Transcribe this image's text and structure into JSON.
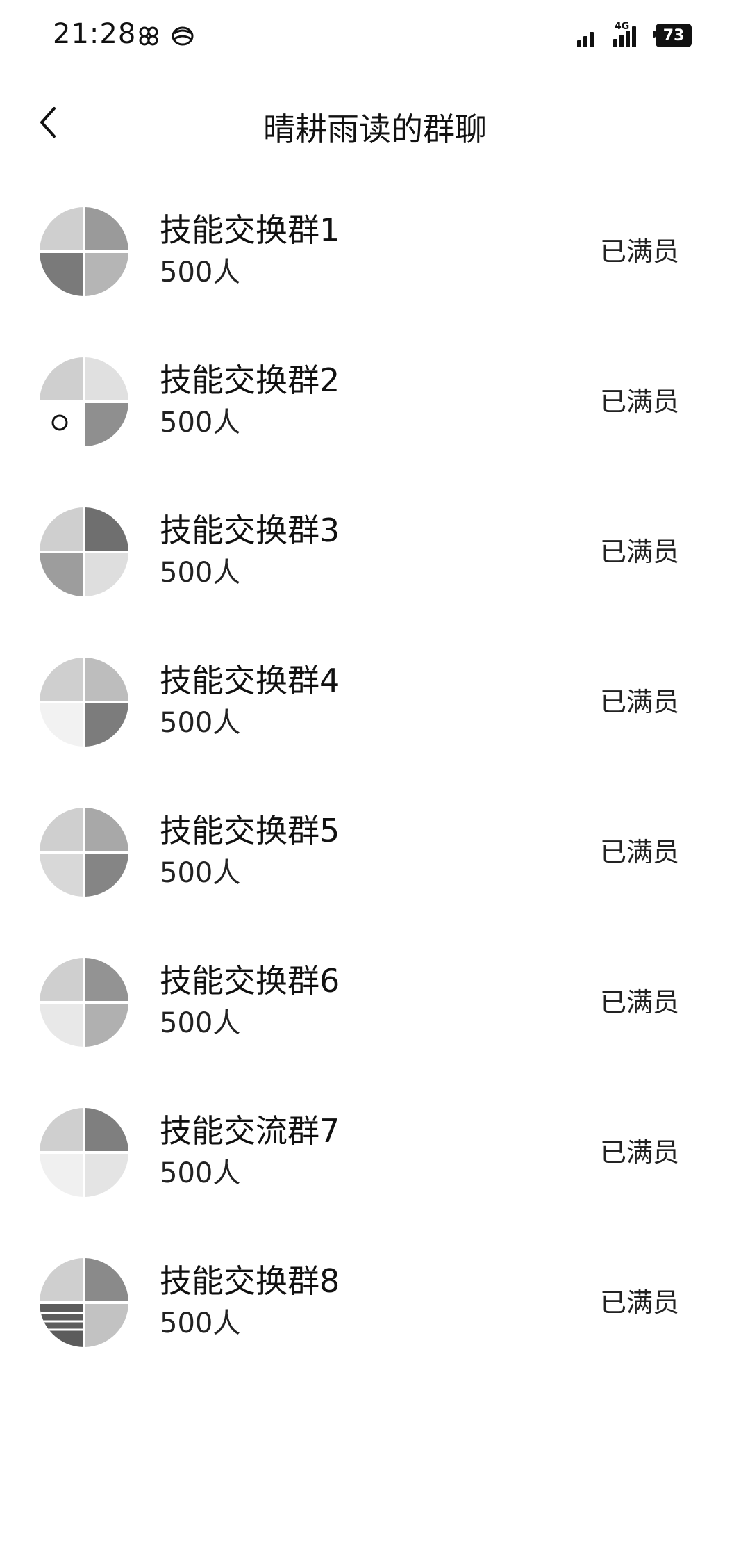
{
  "status_bar": {
    "time": "21:28",
    "network_type": "4G",
    "battery": "73"
  },
  "header": {
    "title": "晴耕雨读的群聊"
  },
  "groups": [
    {
      "name": "技能交换群1",
      "members": "500人",
      "status": "已满员"
    },
    {
      "name": "技能交换群2",
      "members": "500人",
      "status": "已满员"
    },
    {
      "name": "技能交换群3",
      "members": "500人",
      "status": "已满员"
    },
    {
      "name": "技能交换群4",
      "members": "500人",
      "status": "已满员"
    },
    {
      "name": "技能交换群5",
      "members": "500人",
      "status": "已满员"
    },
    {
      "name": "技能交换群6",
      "members": "500人",
      "status": "已满员"
    },
    {
      "name": "技能交流群7",
      "members": "500人",
      "status": "已满员"
    },
    {
      "name": "技能交换群8",
      "members": "500人",
      "status": "已满员"
    }
  ]
}
